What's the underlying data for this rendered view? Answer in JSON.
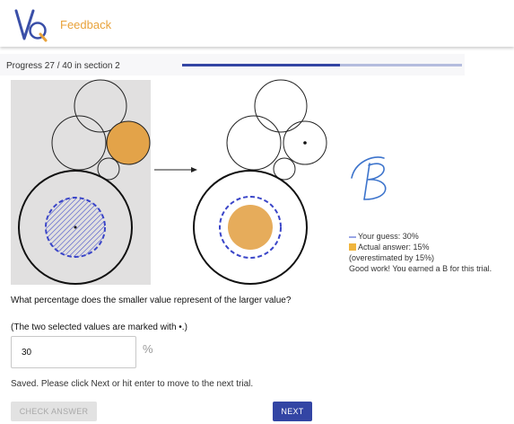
{
  "header": {
    "logo_text": "VQ",
    "title": "Feedback"
  },
  "progress": {
    "label": "Progress 27 / 40 in section 2",
    "current": 27,
    "total": 40,
    "fraction": 0.563
  },
  "stimulus": {
    "marker": "•",
    "colors": {
      "highlight": "#e3a349",
      "hatch": "#3a45c8",
      "panel": "#e1e0e0",
      "arrow": "#222222"
    }
  },
  "feedback": {
    "grade": "B",
    "grade_color": "#3d74cc",
    "guess_label": "Your guess: 30%",
    "actual_label": "Actual answer: 15%",
    "delta_label": "(overestimated by 15%)",
    "message": "Good work! You earned a B for this trial.",
    "colors": {
      "guess": "#9aa6e6",
      "actual": "#f0b53e"
    }
  },
  "question": {
    "text": "What percentage does the smaller value represent of the larger value?",
    "hint": "(The two selected values are marked with •.)"
  },
  "answer": {
    "value": "30",
    "unit": "%"
  },
  "status": {
    "text": "Saved. Please click Next or hit enter to move to the next trial."
  },
  "buttons": {
    "check_label": "CHECK ANSWER",
    "next_label": "NEXT"
  }
}
